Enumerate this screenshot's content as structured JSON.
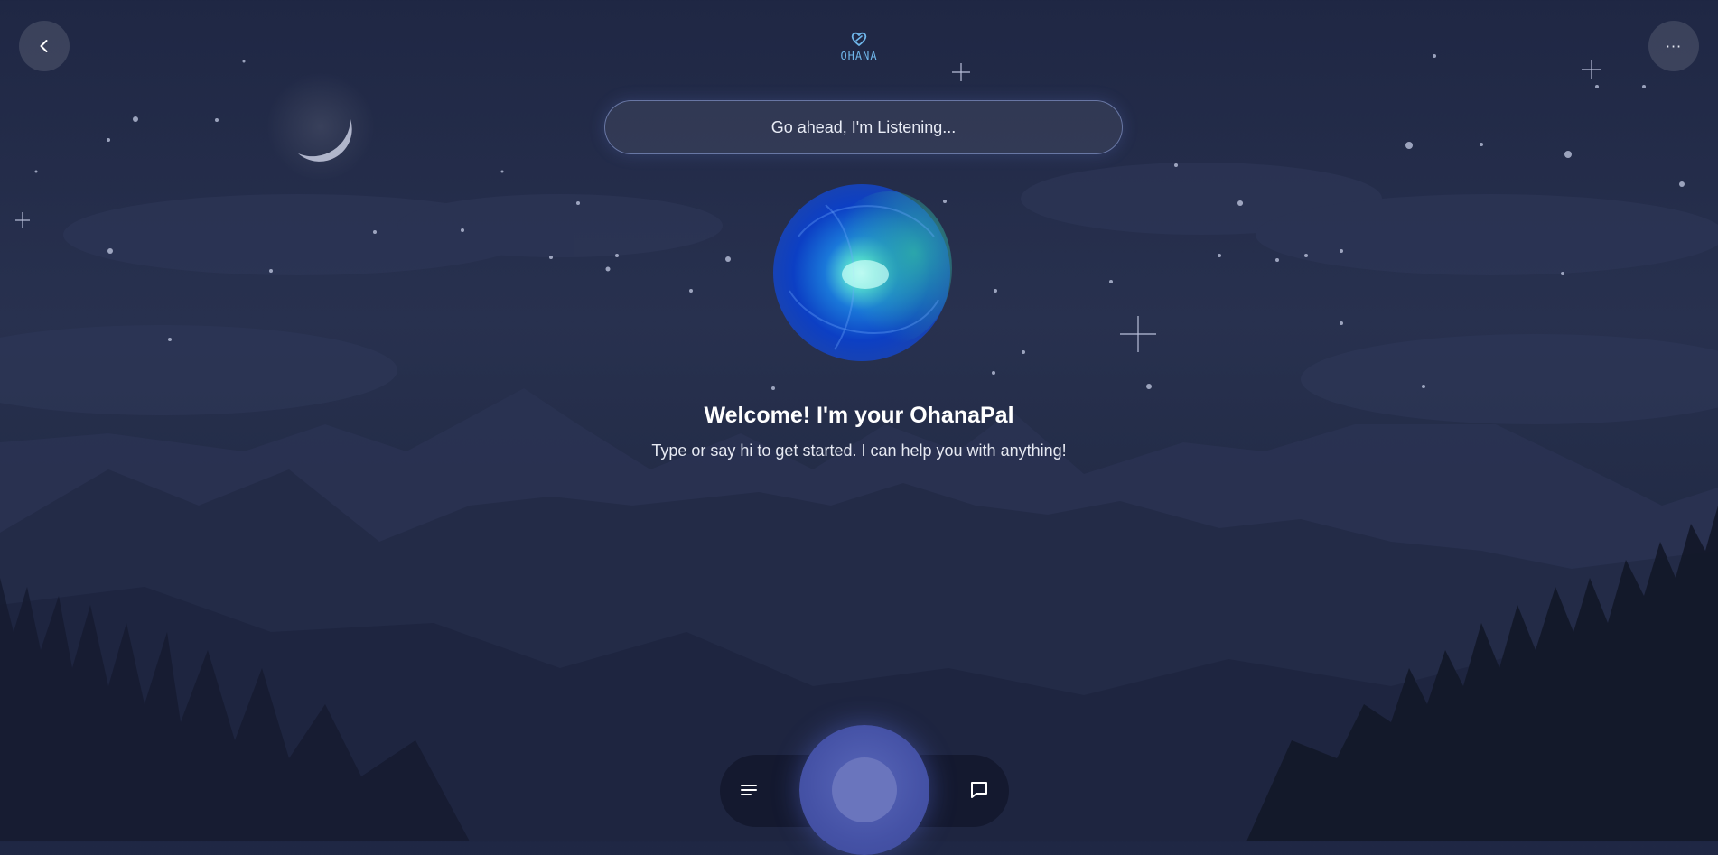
{
  "header": {
    "back_icon": "chevron-left-icon",
    "logo_text": "OHANA",
    "more_icon": "ellipsis-icon",
    "more_label": "···"
  },
  "search": {
    "placeholder": "Go ahead, I'm Listening..."
  },
  "main": {
    "welcome_title": "Welcome! I'm your OhanaPal",
    "welcome_subtitle": "Type or say hi to get started. I can help you with anything!"
  },
  "dock": {
    "menu_icon": "menu-lines-icon",
    "mic_icon": "voice-orb-icon",
    "chat_icon": "chat-bubble-icon"
  },
  "colors": {
    "background": "#232b47",
    "accent": "#4552a6",
    "logo": "#6fb6ea"
  }
}
